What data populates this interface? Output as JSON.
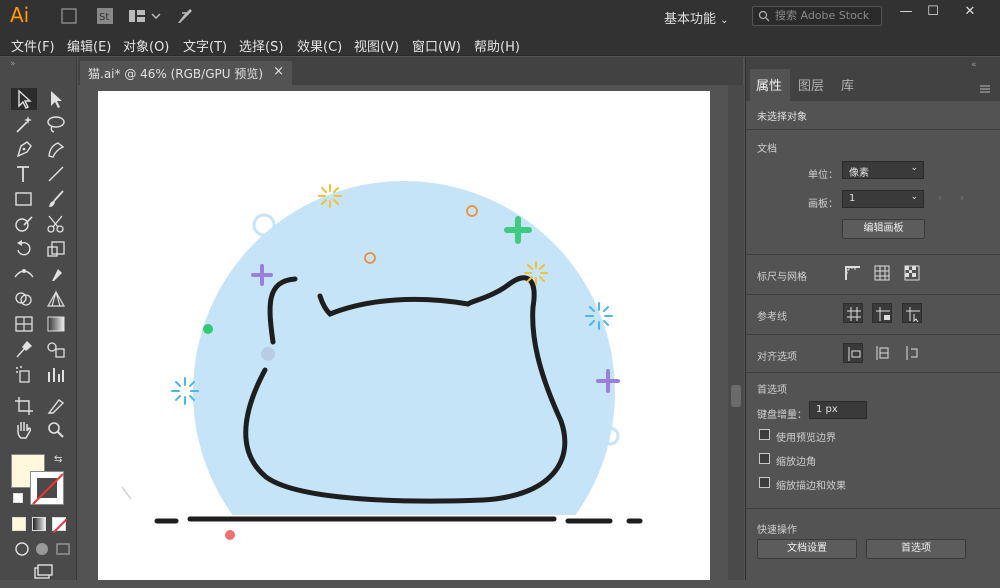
{
  "app": {
    "logo": "Ai",
    "workspace": "基本功能",
    "search_placeholder": "搜索 Adobe Stock"
  },
  "window_controls": {
    "minimize": "—",
    "maximize": "☐",
    "close": "✕"
  },
  "menu": [
    "文件(F)",
    "编辑(E)",
    "对象(O)",
    "文字(T)",
    "选择(S)",
    "效果(C)",
    "视图(V)",
    "窗口(W)",
    "帮助(H)"
  ],
  "document_tab": {
    "title": "猫.ai* @ 46% (RGB/GPU 预览)",
    "close": "×"
  },
  "panel": {
    "tabs": [
      "属性",
      "图层",
      "库"
    ],
    "no_selection": "未选择对象",
    "document_section": "文档",
    "units_label": "单位：",
    "units_value": "像素",
    "artboard_label": "画板：",
    "artboard_value": "1",
    "edit_artboard_button": "编辑画板",
    "rulers_grid": "标尺与网格",
    "guides": "参考线",
    "align_options": "对齐选项",
    "preferences_section": "首选项",
    "keyboard_increment_label": "键盘增量：",
    "keyboard_increment_value": "1 px",
    "checkboxes": [
      "使用预览边界",
      "缩放边角",
      "缩放描边和效果"
    ],
    "quick_actions": "快速操作",
    "doc_settings_button": "文档设置",
    "preferences_button": "首选项"
  },
  "colors": {
    "circle": "#c5e4f7",
    "outline": "#1e1e1e",
    "fill_swatch": "#fef9dc"
  }
}
